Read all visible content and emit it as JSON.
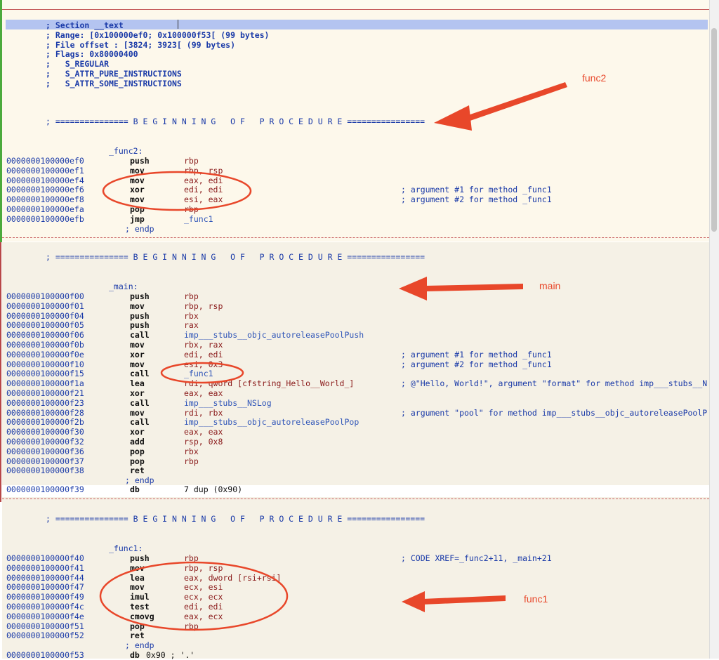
{
  "section": {
    "lines": [
      "; Section __text",
      "; Range: [0x100000ef0; 0x100000f53[ (99 bytes)",
      "; File offset : [3824; 3923[ (99 bytes)",
      "; Flags: 0x80000400",
      ";   S_REGULAR",
      ";   S_ATTR_PURE_INSTRUCTIONS",
      ";   S_ATTR_SOME_INSTRUCTIONS"
    ]
  },
  "procedure_banner": "; =============== B E G I N N I N G   O F   P R O C E D U R E ================",
  "endp": "; endp",
  "func2": {
    "label": "_func2:",
    "rows": [
      {
        "addr": "0000000100000ef0",
        "op": "push",
        "args": "rbp",
        "comment": ""
      },
      {
        "addr": "0000000100000ef1",
        "op": "mov",
        "args": "rbp, rsp",
        "comment": ""
      },
      {
        "addr": "0000000100000ef4",
        "op": "mov",
        "args": "eax, edi",
        "comment": ""
      },
      {
        "addr": "0000000100000ef6",
        "op": "xor",
        "args": "edi, edi",
        "comment": "; argument #1 for method _func1"
      },
      {
        "addr": "0000000100000ef8",
        "op": "mov",
        "args": "esi, eax",
        "comment": "; argument #2 for method _func1"
      },
      {
        "addr": "0000000100000efa",
        "op": "pop",
        "args": "rbp",
        "comment": ""
      },
      {
        "addr": "0000000100000efb",
        "op": "jmp",
        "args": "_func1",
        "comment": ""
      }
    ]
  },
  "main": {
    "label": "_main:",
    "rows": [
      {
        "addr": "0000000100000f00",
        "op": "push",
        "args": "rbp",
        "comment": ""
      },
      {
        "addr": "0000000100000f01",
        "op": "mov",
        "args": "rbp, rsp",
        "comment": ""
      },
      {
        "addr": "0000000100000f04",
        "op": "push",
        "args": "rbx",
        "comment": ""
      },
      {
        "addr": "0000000100000f05",
        "op": "push",
        "args": "rax",
        "comment": ""
      },
      {
        "addr": "0000000100000f06",
        "op": "call",
        "args": "imp___stubs__objc_autoreleasePoolPush",
        "comment": ""
      },
      {
        "addr": "0000000100000f0b",
        "op": "mov",
        "args": "rbx, rax",
        "comment": ""
      },
      {
        "addr": "0000000100000f0e",
        "op": "xor",
        "args": "edi, edi",
        "comment": "; argument #1 for method _func1"
      },
      {
        "addr": "0000000100000f10",
        "op": "mov",
        "args": "esi, 0x3",
        "comment": "; argument #2 for method _func1"
      },
      {
        "addr": "0000000100000f15",
        "op": "call",
        "args": "_func1",
        "comment": ""
      },
      {
        "addr": "0000000100000f1a",
        "op": "lea",
        "args": "rdi, qword [cfstring_Hello__World_]",
        "comment": "; @\"Hello, World!\", argument \"format\" for method imp___stubs__N"
      },
      {
        "addr": "0000000100000f21",
        "op": "xor",
        "args": "eax, eax",
        "comment": ""
      },
      {
        "addr": "0000000100000f23",
        "op": "call",
        "args": "imp___stubs__NSLog",
        "comment": ""
      },
      {
        "addr": "0000000100000f28",
        "op": "mov",
        "args": "rdi, rbx",
        "comment": "; argument \"pool\" for method imp___stubs__objc_autoreleasePoolP"
      },
      {
        "addr": "0000000100000f2b",
        "op": "call",
        "args": "imp___stubs__objc_autoreleasePoolPop",
        "comment": ""
      },
      {
        "addr": "0000000100000f30",
        "op": "xor",
        "args": "eax, eax",
        "comment": ""
      },
      {
        "addr": "0000000100000f32",
        "op": "add",
        "args": "rsp, 0x8",
        "comment": ""
      },
      {
        "addr": "0000000100000f36",
        "op": "pop",
        "args": "rbx",
        "comment": ""
      },
      {
        "addr": "0000000100000f37",
        "op": "pop",
        "args": "rbp",
        "comment": ""
      },
      {
        "addr": "0000000100000f38",
        "op": "ret",
        "args": "",
        "comment": ""
      }
    ],
    "db_row": {
      "addr": "0000000100000f39",
      "op": "db",
      "args": "7 dup (0x90)"
    }
  },
  "func1": {
    "label": "_func1:",
    "rows": [
      {
        "addr": "0000000100000f40",
        "op": "push",
        "args": "rbp",
        "comment": "; CODE XREF=_func2+11, _main+21"
      },
      {
        "addr": "0000000100000f41",
        "op": "mov",
        "args": "rbp, rsp",
        "comment": ""
      },
      {
        "addr": "0000000100000f44",
        "op": "lea",
        "args": "eax, dword [rsi+rsi]",
        "comment": ""
      },
      {
        "addr": "0000000100000f47",
        "op": "mov",
        "args": "ecx, esi",
        "comment": ""
      },
      {
        "addr": "0000000100000f49",
        "op": "imul",
        "args": "ecx, ecx",
        "comment": ""
      },
      {
        "addr": "0000000100000f4c",
        "op": "test",
        "args": "edi, edi",
        "comment": ""
      },
      {
        "addr": "0000000100000f4e",
        "op": "cmovg",
        "args": "eax, ecx",
        "comment": ""
      },
      {
        "addr": "0000000100000f51",
        "op": "pop",
        "args": "rbp",
        "comment": ""
      },
      {
        "addr": "0000000100000f52",
        "op": "ret",
        "args": "",
        "comment": ""
      }
    ],
    "db_row": {
      "addr": "0000000100000f53",
      "op": "db",
      "args": "0x90 ; '.'"
    }
  },
  "annotations": {
    "func2": "func2",
    "main": "main",
    "func1": "func1"
  },
  "colors": {
    "annotation": "#e8472a",
    "listing_blue": "#1a3aa8",
    "operand_red": "#8a1a1a"
  }
}
